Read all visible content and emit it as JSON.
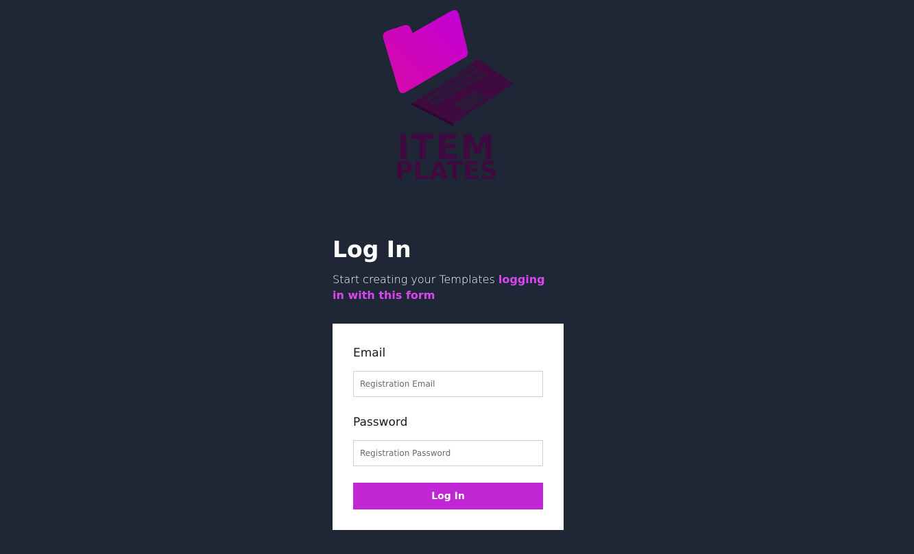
{
  "logo": {
    "line1": "ITEM",
    "line2": "PLATES",
    "icon": "laptop-folder-icon",
    "colors": {
      "screen_start": "#d60aa6",
      "screen_end": "#c100d6",
      "base": "#3e0a3f",
      "text": "#3e0a3f"
    }
  },
  "heading": "Log In",
  "subtitle": {
    "prefix": "Start creating your Templates ",
    "accent": "logging in with this form"
  },
  "form": {
    "email": {
      "label": "Email",
      "placeholder": "Registration Email",
      "value": ""
    },
    "password": {
      "label": "Password",
      "placeholder": "Registration Password",
      "value": ""
    },
    "submit_label": "Log In"
  },
  "colors": {
    "background": "#1f2737",
    "accent": "#d946ef",
    "button": "#c026d3",
    "card": "#ffffff"
  }
}
